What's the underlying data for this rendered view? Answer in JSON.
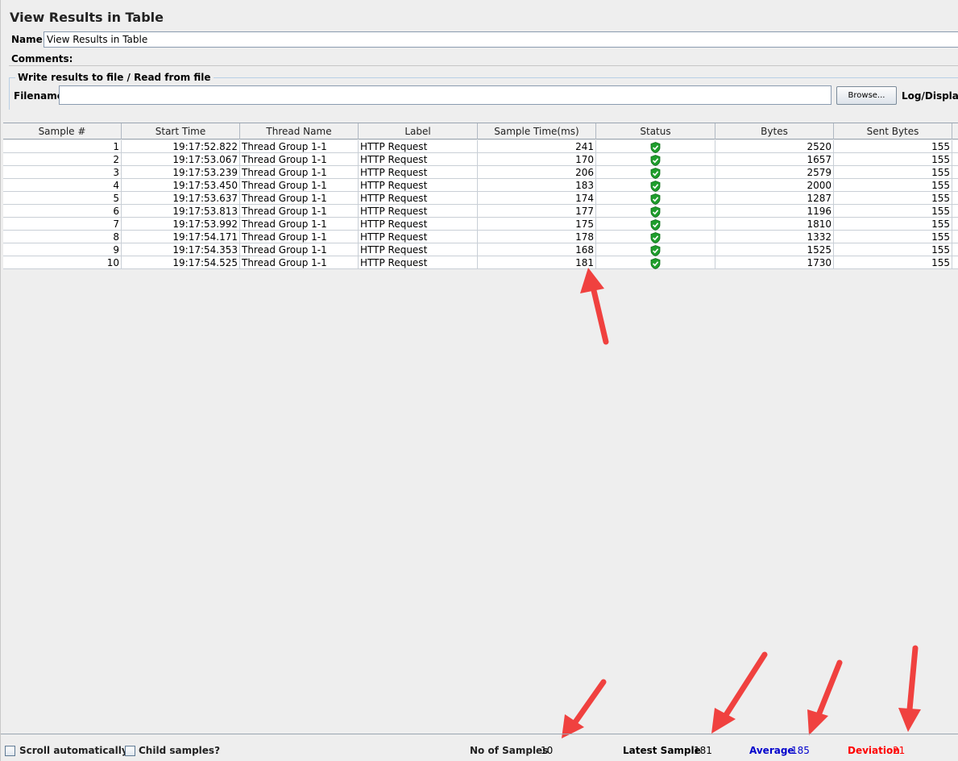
{
  "title": "View Results in Table",
  "name": {
    "label": "Name:",
    "value": "View Results in Table"
  },
  "comments": {
    "label": "Comments:"
  },
  "file_section": {
    "legend": "Write results to file / Read from file",
    "filename_label": "Filename",
    "browse_label": "Browse...",
    "log_label": "Log/Display O"
  },
  "table": {
    "columns": [
      "Sample #",
      "Start Time",
      "Thread Name",
      "Label",
      "Sample Time(ms)",
      "Status",
      "Bytes",
      "Sent Bytes"
    ],
    "rows": [
      {
        "sample": "1",
        "start": "19:17:52.822",
        "thread": "Thread Group 1-1",
        "label": "HTTP Request",
        "time": "241",
        "bytes": "2520",
        "sent": "155"
      },
      {
        "sample": "2",
        "start": "19:17:53.067",
        "thread": "Thread Group 1-1",
        "label": "HTTP Request",
        "time": "170",
        "bytes": "1657",
        "sent": "155"
      },
      {
        "sample": "3",
        "start": "19:17:53.239",
        "thread": "Thread Group 1-1",
        "label": "HTTP Request",
        "time": "206",
        "bytes": "2579",
        "sent": "155"
      },
      {
        "sample": "4",
        "start": "19:17:53.450",
        "thread": "Thread Group 1-1",
        "label": "HTTP Request",
        "time": "183",
        "bytes": "2000",
        "sent": "155"
      },
      {
        "sample": "5",
        "start": "19:17:53.637",
        "thread": "Thread Group 1-1",
        "label": "HTTP Request",
        "time": "174",
        "bytes": "1287",
        "sent": "155"
      },
      {
        "sample": "6",
        "start": "19:17:53.813",
        "thread": "Thread Group 1-1",
        "label": "HTTP Request",
        "time": "177",
        "bytes": "1196",
        "sent": "155"
      },
      {
        "sample": "7",
        "start": "19:17:53.992",
        "thread": "Thread Group 1-1",
        "label": "HTTP Request",
        "time": "175",
        "bytes": "1810",
        "sent": "155"
      },
      {
        "sample": "8",
        "start": "19:17:54.171",
        "thread": "Thread Group 1-1",
        "label": "HTTP Request",
        "time": "178",
        "bytes": "1332",
        "sent": "155"
      },
      {
        "sample": "9",
        "start": "19:17:54.353",
        "thread": "Thread Group 1-1",
        "label": "HTTP Request",
        "time": "168",
        "bytes": "1525",
        "sent": "155"
      },
      {
        "sample": "10",
        "start": "19:17:54.525",
        "thread": "Thread Group 1-1",
        "label": "HTTP Request",
        "time": "181",
        "bytes": "1730",
        "sent": "155"
      }
    ],
    "status_icon": "success-shield-icon"
  },
  "footer": {
    "scroll_label": "Scroll automatically?",
    "child_label": "Child samples?",
    "no_samples_label": "No of Samples",
    "no_samples_value": "10",
    "latest_label": "Latest Sample",
    "latest_value": "181",
    "average_label": "Average",
    "average_value": "185",
    "deviation_label": "Deviation",
    "deviation_value": "21"
  },
  "colors": {
    "average": "#0000cc",
    "deviation": "#ff0000",
    "arrow": "#f0413f",
    "success": "#1e9e2c"
  }
}
